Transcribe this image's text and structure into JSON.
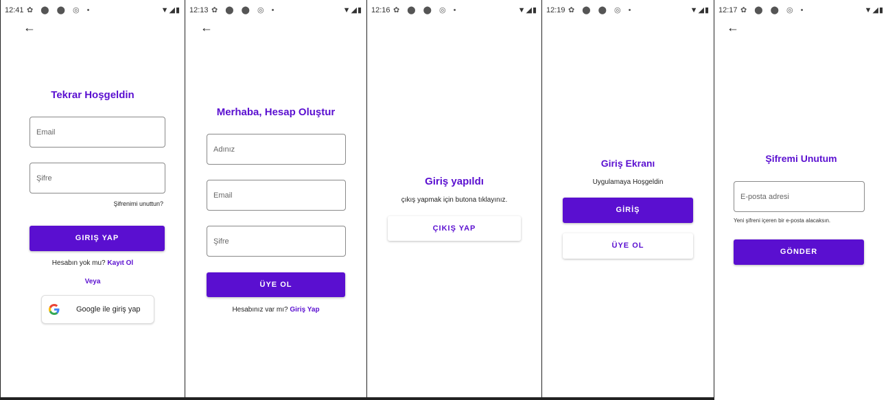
{
  "status_bars": [
    {
      "time": "12:41"
    },
    {
      "time": "12:13"
    },
    {
      "time": "12:16"
    },
    {
      "time": "12:19"
    },
    {
      "time": "12:17"
    }
  ],
  "status_icons": "✿ ⬤ ⬤ ◎ •",
  "status_right": "▼◢▮",
  "login": {
    "title": "Tekrar Hoşgeldin",
    "email_placeholder": "Email",
    "password_placeholder": "Şifre",
    "forgot": "Şifrenimi unuttun?",
    "login_button": "GIRIŞ YAP",
    "no_account": "Hesabın yok mu?",
    "register_link": "Kayıt Ol",
    "or": "Veya",
    "google_button": "Google ile giriş yap"
  },
  "register": {
    "title": "Merhaba, Hesap Oluştur",
    "name_placeholder": "Adınız",
    "email_placeholder": "Email",
    "password_placeholder": "Şifre",
    "register_button": "ÜYE OL",
    "have_account": "Hesabınız var mı?",
    "login_link": "Giriş Yap"
  },
  "logged_in": {
    "title": "Giriş yapıldı",
    "subtitle": "çıkış yapmak için butona tıklayınız.",
    "logout_button": "ÇIKIŞ YAP"
  },
  "welcome": {
    "title": "Giriş Ekranı",
    "subtitle": "Uygulamaya Hoşgeldin",
    "login_button": "GİRİŞ",
    "register_button": "ÜYE OL"
  },
  "forgot": {
    "title": "Şifremi Unutum",
    "email_placeholder": "E-posta adresi",
    "hint": "Yeni şifreni içeren bir e-posta alacaksın.",
    "send_button": "GÖNDER"
  },
  "colors": {
    "accent": "#5a0fd0"
  }
}
